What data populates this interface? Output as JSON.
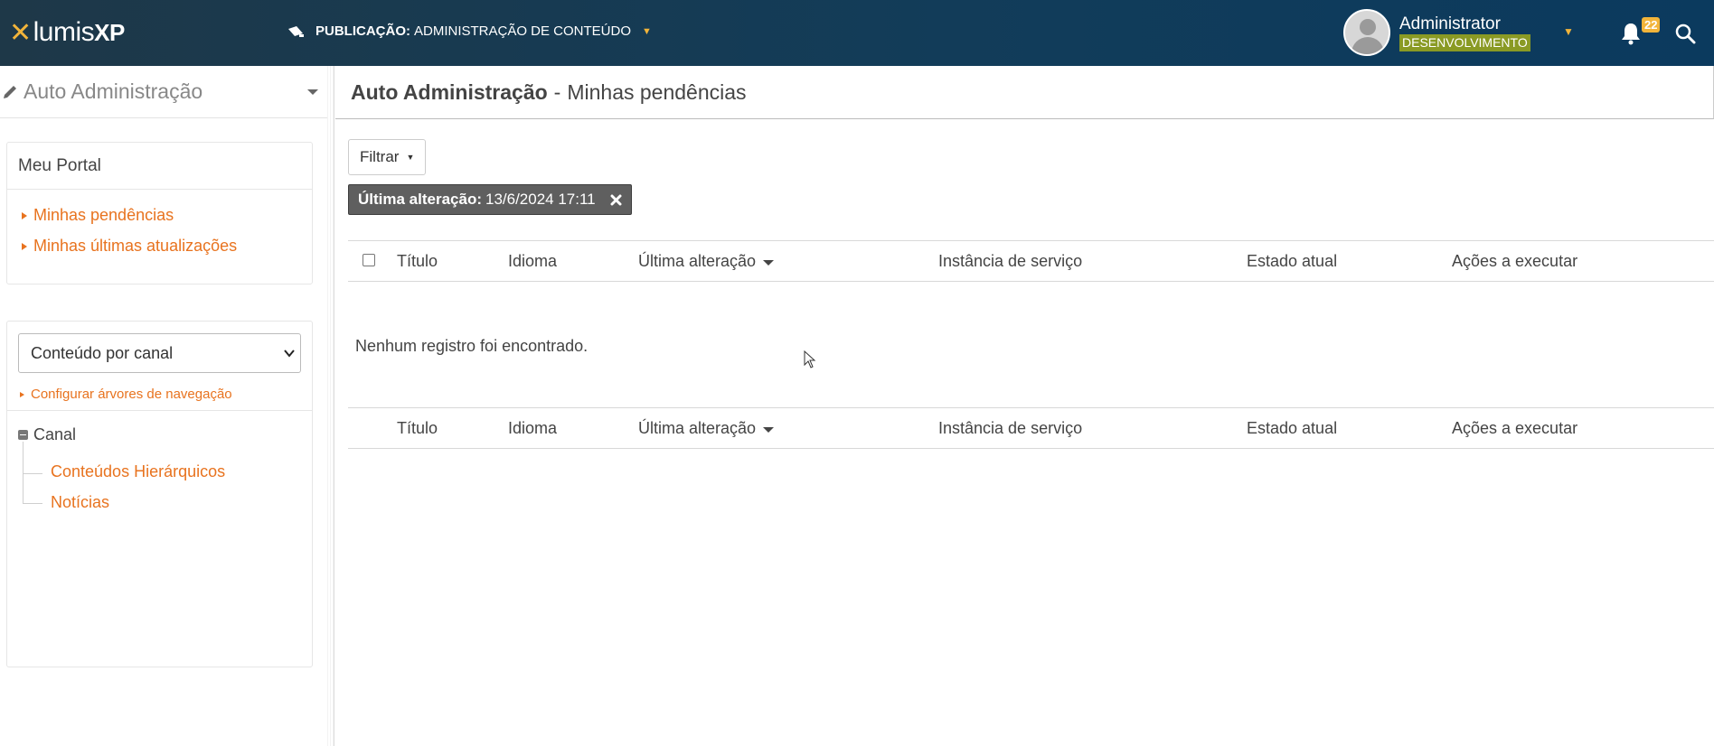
{
  "header": {
    "logo_lumis": "lumis",
    "logo_xp": "XP",
    "publication_label": "PUBLICAÇÃO:",
    "publication_value": "ADMINISTRAÇÃO DE CONTEÚDO",
    "user_name": "Administrator",
    "environment": "DESENVOLVIMENTO",
    "notification_count": "22"
  },
  "sidebar": {
    "title": "Auto Administração",
    "portal_box": {
      "title": "Meu Portal",
      "links": [
        "Minhas pendências",
        "Minhas últimas atualizações"
      ]
    },
    "content_select": {
      "selected": "Conteúdo por canal"
    },
    "config_link": "Configurar árvores de navegação",
    "tree": {
      "root": "Canal",
      "children": [
        "Conteúdos Hierárquicos",
        "Notícias"
      ]
    }
  },
  "main": {
    "title_bold": "Auto Administração",
    "title_separator": "-",
    "title_rest": "Minhas pendências",
    "filter_button": "Filtrar",
    "filter_chip": {
      "label": "Última alteração:",
      "value": "13/6/2024 17:11"
    },
    "columns": [
      "Título",
      "Idioma",
      "Última alteração",
      "Instância de serviço",
      "Estado atual",
      "Ações a executar"
    ],
    "empty_message": "Nenhum registro foi encontrado."
  },
  "colors": {
    "header_bg": "#123c59",
    "accent_orange": "#e8731f",
    "accent_yellow": "#f2b43a",
    "env_badge": "#8a9a24",
    "chip_bg": "#5f5f5f"
  },
  "icons": [
    "logo-x-icon",
    "publication-icon",
    "avatar-icon",
    "chevron-down-icon",
    "bell-icon",
    "search-icon",
    "pencil-icon",
    "close-icon",
    "tree-collapse-icon",
    "mouse-cursor-icon"
  ]
}
